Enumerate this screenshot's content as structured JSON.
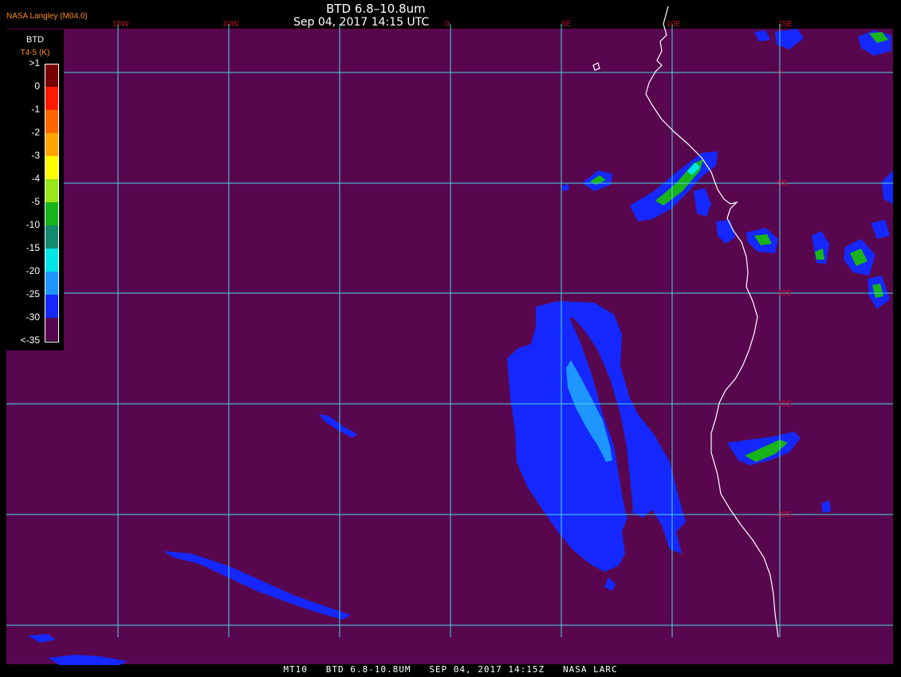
{
  "header": {
    "product_title": "BTD 6.8–10.8um",
    "datetime": "Sep 04, 2017 14:15 UTC",
    "org_label": "NASA Langley (M04.0)"
  },
  "footer": {
    "caption": "MT10   BTD 6.8-10.8UM   SEP 04, 2017 14:15Z   NASA LARC"
  },
  "legend": {
    "title": "BTD",
    "subtitle": "T4-5 (K)",
    "levels": [
      {
        "label": ">1",
        "color": "#7a0000"
      },
      {
        "label": "0",
        "color": "#ff1a00"
      },
      {
        "label": "-1",
        "color": "#ff6600"
      },
      {
        "label": "-2",
        "color": "#ffa500"
      },
      {
        "label": "-3",
        "color": "#ffff00"
      },
      {
        "label": "-4",
        "color": "#99e619"
      },
      {
        "label": "-5",
        "color": "#19b419"
      },
      {
        "label": "-10",
        "color": "#128a6e"
      },
      {
        "label": "-15",
        "color": "#00e6e6"
      },
      {
        "label": "-20",
        "color": "#1e96ff"
      },
      {
        "label": "-25",
        "color": "#1428ff"
      },
      {
        "label": "-30",
        "color": "#58074f"
      },
      {
        "label": "<-35",
        "color": "#58074f"
      }
    ]
  },
  "grid": {
    "lon_labels": [
      "15W",
      "10W",
      "0",
      "5E",
      "10E",
      "15E"
    ],
    "lat_labels": [
      "0",
      "5S",
      "10S",
      "15S",
      "20S"
    ],
    "line_color": "#4ad7e6",
    "label_color": "#c0102a"
  },
  "colors": {
    "background": "#58074f",
    "coast": "#ffffff",
    "ash_dark": "#1428ff",
    "ash_light": "#1e96ff",
    "cloud_green": "#19b419",
    "cloud_cyan": "#00e6e6"
  }
}
